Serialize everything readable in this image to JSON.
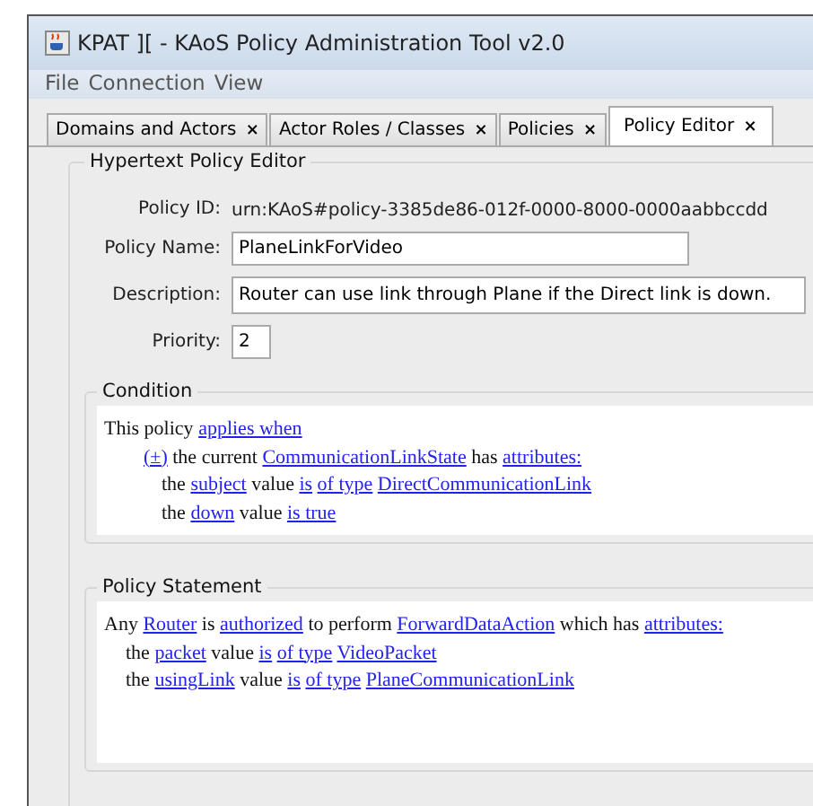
{
  "window": {
    "title": "KPAT ][ - KAoS Policy Administration Tool v2.0"
  },
  "menu": [
    "File",
    "Connection",
    "View"
  ],
  "tabs": [
    {
      "label": "Domains and Actors",
      "close": "×",
      "selected": false
    },
    {
      "label": "Actor Roles / Classes",
      "close": "×",
      "selected": false
    },
    {
      "label": "Policies",
      "close": "×",
      "selected": false
    },
    {
      "label": "Policy Editor",
      "close": "×",
      "selected": true
    }
  ],
  "editor": {
    "title": "Hypertext Policy Editor",
    "fields": [
      {
        "kind": "text",
        "label": "Policy ID:",
        "value": "urn:KAoS#policy-3385de86-012f-0000-8000-0000aabbccdd"
      },
      {
        "kind": "input",
        "label": "Policy Name:",
        "value": "PlaneLinkForVideo"
      },
      {
        "kind": "wide",
        "label": "Description:",
        "value": "Router can use link through Plane if the Direct link is down."
      },
      {
        "kind": "small",
        "label": "Priority:",
        "value": "2"
      }
    ],
    "sections": [
      {
        "title": "Condition",
        "lines": [
          {
            "parts": [
              {
                "text": "This policy",
                "link": false
              },
              {
                "text": "applies when",
                "link": true
              }
            ],
            "children": [
              {
                "parts": [
                  {
                    "text": "(±)",
                    "link": true
                  },
                  {
                    "text": "the current",
                    "link": false
                  },
                  {
                    "text": "CommunicationLinkState",
                    "link": true
                  },
                  {
                    "text": "has",
                    "link": false
                  },
                  {
                    "text": "attributes:",
                    "link": true
                  }
                ],
                "children": [
                  {
                    "parts": [
                      {
                        "text": "the",
                        "link": false
                      },
                      {
                        "text": "subject",
                        "link": true
                      },
                      {
                        "text": "value",
                        "link": false
                      },
                      {
                        "text": "is",
                        "link": true
                      },
                      {
                        "text": "of type",
                        "link": true
                      },
                      {
                        "text": "DirectCommunicationLink",
                        "link": true
                      }
                    ]
                  },
                  {
                    "parts": [
                      {
                        "text": "the",
                        "link": false
                      },
                      {
                        "text": "down",
                        "link": true
                      },
                      {
                        "text": "value",
                        "link": false
                      },
                      {
                        "text": "is true",
                        "link": true
                      }
                    ]
                  }
                ]
              }
            ]
          }
        ]
      },
      {
        "title": "Policy Statement",
        "lines": [
          {
            "parts": [
              {
                "text": "Any",
                "link": false
              },
              {
                "text": "Router",
                "link": true
              },
              {
                "text": "is",
                "link": false
              },
              {
                "text": "authorized",
                "link": true
              },
              {
                "text": "to perform",
                "link": false
              },
              {
                "text": "ForwardDataAction",
                "link": true
              },
              {
                "text": "which has",
                "link": false
              },
              {
                "text": "attributes:",
                "link": true
              }
            ],
            "children": [
              {
                "parts": [
                  {
                    "text": "the",
                    "link": false
                  },
                  {
                    "text": "packet",
                    "link": true
                  },
                  {
                    "text": "value",
                    "link": false
                  },
                  {
                    "text": "is",
                    "link": true
                  },
                  {
                    "text": "of type",
                    "link": true
                  },
                  {
                    "text": "VideoPacket",
                    "link": true
                  }
                ]
              },
              {
                "parts": [
                  {
                    "text": "the",
                    "link": false
                  },
                  {
                    "text": "usingLink",
                    "link": true
                  },
                  {
                    "text": "value",
                    "link": false
                  },
                  {
                    "text": "is",
                    "link": true
                  },
                  {
                    "text": "of type",
                    "link": true
                  },
                  {
                    "text": "PlaneCommunicationLink",
                    "link": true
                  }
                ]
              }
            ]
          }
        ]
      }
    ]
  }
}
